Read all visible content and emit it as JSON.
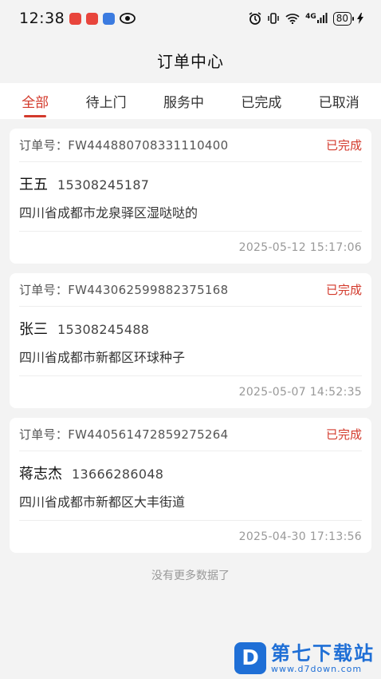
{
  "status_bar": {
    "time": "12:38",
    "network": "4G",
    "battery": "80",
    "app_icon_colors": [
      "#e8453c",
      "#e8453c",
      "#3b7be0"
    ]
  },
  "header": {
    "title": "订单中心"
  },
  "tabs": [
    {
      "label": "全部",
      "active": true
    },
    {
      "label": "待上门",
      "active": false
    },
    {
      "label": "服务中",
      "active": false
    },
    {
      "label": "已完成",
      "active": false
    },
    {
      "label": "已取消",
      "active": false
    }
  ],
  "orders": [
    {
      "order_no": "订单号：FW444880708331110400",
      "status": "已完成",
      "name": "王五",
      "phone": "15308245187",
      "address": "四川省成都市龙泉驿区湿哒哒的",
      "time": "2025-05-12 15:17:06"
    },
    {
      "order_no": "订单号：FW443062599882375168",
      "status": "已完成",
      "name": "张三",
      "phone": "15308245488",
      "address": "四川省成都市新都区环球种子",
      "time": "2025-05-07 14:52:35"
    },
    {
      "order_no": "订单号：FW440561472859275264",
      "status": "已完成",
      "name": "蒋志杰",
      "phone": "13666286048",
      "address": "四川省成都市新都区大丰街道",
      "time": "2025-04-30 17:13:56"
    }
  ],
  "list_footer": "没有更多数据了",
  "watermark": {
    "logo": "D",
    "title": "第七下载站",
    "url": "www.d7down.com"
  },
  "colors": {
    "accent": "#d33a2c",
    "background": "#f3f3f3"
  }
}
